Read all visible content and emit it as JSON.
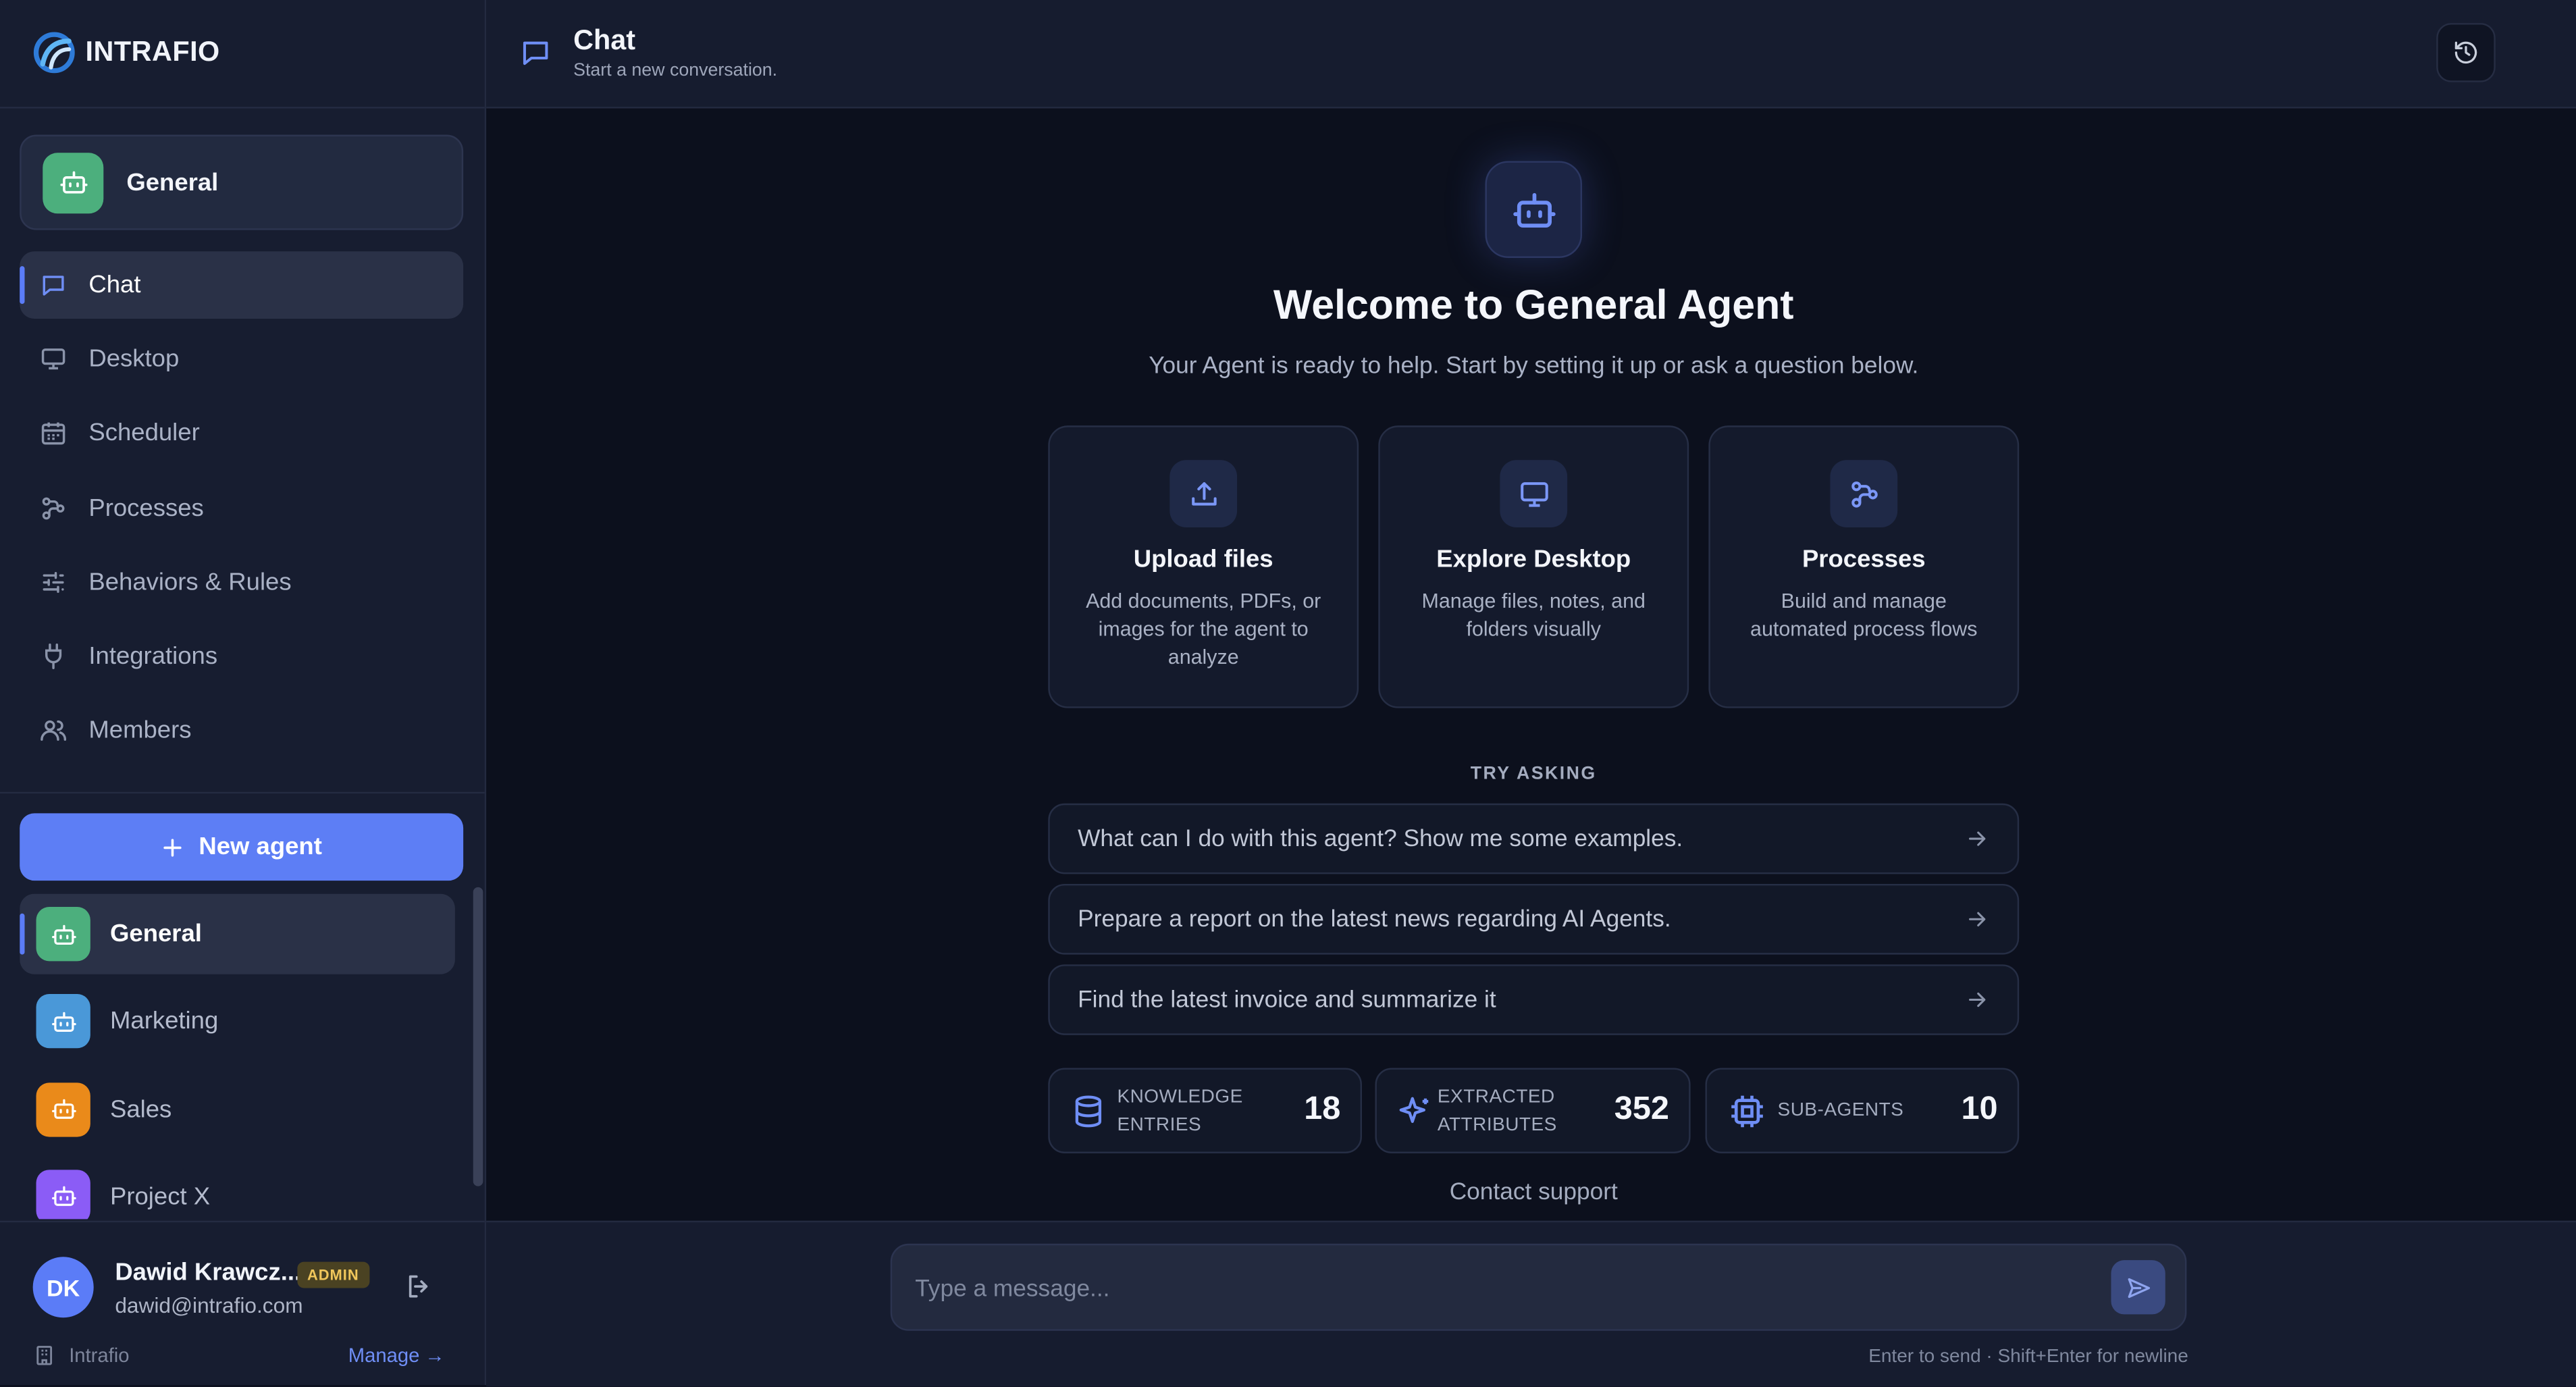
{
  "brand": {
    "name": "INTRAFIO"
  },
  "sidebar": {
    "current_agent": {
      "name": "General",
      "color": "#4caf7d"
    },
    "nav": [
      {
        "label": "Chat",
        "icon": "chat-bubble-icon",
        "active": true
      },
      {
        "label": "Desktop",
        "icon": "monitor-icon"
      },
      {
        "label": "Scheduler",
        "icon": "calendar-icon"
      },
      {
        "label": "Processes",
        "icon": "workflow-icon"
      },
      {
        "label": "Behaviors & Rules",
        "icon": "sliders-icon"
      },
      {
        "label": "Integrations",
        "icon": "plug-icon"
      },
      {
        "label": "Members",
        "icon": "users-icon"
      }
    ],
    "new_agent_label": "New agent",
    "agents": [
      {
        "name": "General",
        "color": "#4caf7d",
        "active": true
      },
      {
        "name": "Marketing",
        "color": "#4a98d8"
      },
      {
        "name": "Sales",
        "color": "#ea8a1a"
      },
      {
        "name": "Project X",
        "color": "#8b5cf6"
      }
    ],
    "user": {
      "initials": "DK",
      "name": "Dawid Krawcz...",
      "role": "ADMIN",
      "email": "dawid@intrafio.com"
    },
    "org": {
      "name": "Intrafio",
      "manage_label": "Manage →"
    }
  },
  "header": {
    "title": "Chat",
    "subtitle": "Start a new conversation."
  },
  "main": {
    "welcome_title": "Welcome to General Agent",
    "welcome_subtitle": "Your Agent is ready to help. Start by setting it up or ask a question below.",
    "features": [
      {
        "title": "Upload files",
        "description": "Add documents, PDFs, or images for the agent to analyze",
        "icon": "upload-icon"
      },
      {
        "title": "Explore Desktop",
        "description": "Manage files, notes, and folders visually",
        "icon": "monitor-icon"
      },
      {
        "title": "Processes",
        "description": "Build and manage automated process flows",
        "icon": "workflow-icon"
      }
    ],
    "try_asking_label": "TRY ASKING",
    "prompts": [
      "What can I do with this agent? Show me some examples.",
      "Prepare a report on the latest news regarding AI Agents.",
      "Find the latest invoice and summarize it"
    ],
    "stats": [
      {
        "label_line1": "KNOWLEDGE",
        "label_line2": "ENTRIES",
        "value": "18",
        "icon": "database-icon"
      },
      {
        "label_line1": "EXTRACTED",
        "label_line2": "ATTRIBUTES",
        "value": "352",
        "icon": "sparkles-icon"
      },
      {
        "label_line1": "SUB-AGENTS",
        "label_line2": "",
        "value": "10",
        "icon": "cpu-icon"
      }
    ],
    "contact_support": "Contact support"
  },
  "composer": {
    "placeholder": "Type a message...",
    "hint": "Enter to send · Shift+Enter for newline"
  },
  "colors": {
    "accent": "#5b7cf7",
    "background": "#0c101d",
    "sidebar": "#171d30",
    "admin_badge": "#f0c65b"
  }
}
